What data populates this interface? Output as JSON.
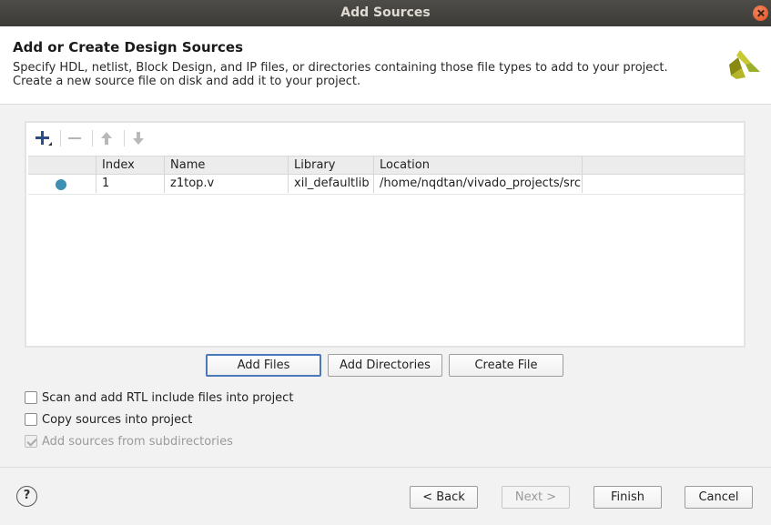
{
  "window": {
    "title": "Add Sources"
  },
  "header": {
    "title": "Add or Create Design Sources",
    "description": "Specify HDL, netlist, Block Design, and IP files, or directories containing those file types to add to your project. Create a new source file on disk and add it to your project."
  },
  "table": {
    "columns": [
      "",
      "Index",
      "Name",
      "Library",
      "Location"
    ],
    "rows": [
      {
        "index": "1",
        "name": "z1top.v",
        "library": "xil_defaultlib",
        "location": "/home/nqdtan/vivado_projects/src"
      }
    ]
  },
  "file_buttons": {
    "add_files": "Add Files",
    "add_directories": "Add Directories",
    "create_file": "Create File"
  },
  "options": {
    "scan_rtl": {
      "label": "Scan and add RTL include files into project",
      "checked": false
    },
    "copy_sources": {
      "label": "Copy sources into project",
      "checked": false
    },
    "subdirectories": {
      "label": "Add sources from subdirectories",
      "checked": true,
      "disabled": true
    }
  },
  "footer": {
    "help": "?",
    "back": "< Back",
    "next": "Next >",
    "finish": "Finish",
    "cancel": "Cancel"
  },
  "colors": {
    "accent": "#4a78b8",
    "status_dot": "#3e8fb3",
    "titlebar": "#3c3b37"
  }
}
